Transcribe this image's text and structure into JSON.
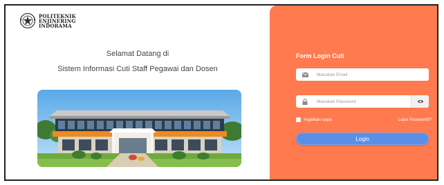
{
  "brand": {
    "name_lines": [
      "POLITEKNIK",
      "ENJINERING",
      "INDORAMA"
    ],
    "logo_icon": "institution-emblem-icon"
  },
  "welcome": {
    "line1": "Selamat Datang di",
    "line2": "Sistem Informasi Cuti Staff Pegawai dan Dosen"
  },
  "hero_image": {
    "subject": "campus-building-photo"
  },
  "login_form": {
    "title": "Form Login Cuti",
    "email_placeholder": "Masukan Email",
    "email_icon": "envelope-icon",
    "password_placeholder": "Masukan Password",
    "password_icon": "lock-icon",
    "toggle_icon": "eye-icon",
    "remember_label": "Ingatkan saya",
    "forgot_label": "Lupa Password?",
    "submit_label": "Login"
  },
  "colors": {
    "panel": "#ff7a4f",
    "button": "#5b8fe6",
    "text_light": "#ffffff"
  }
}
